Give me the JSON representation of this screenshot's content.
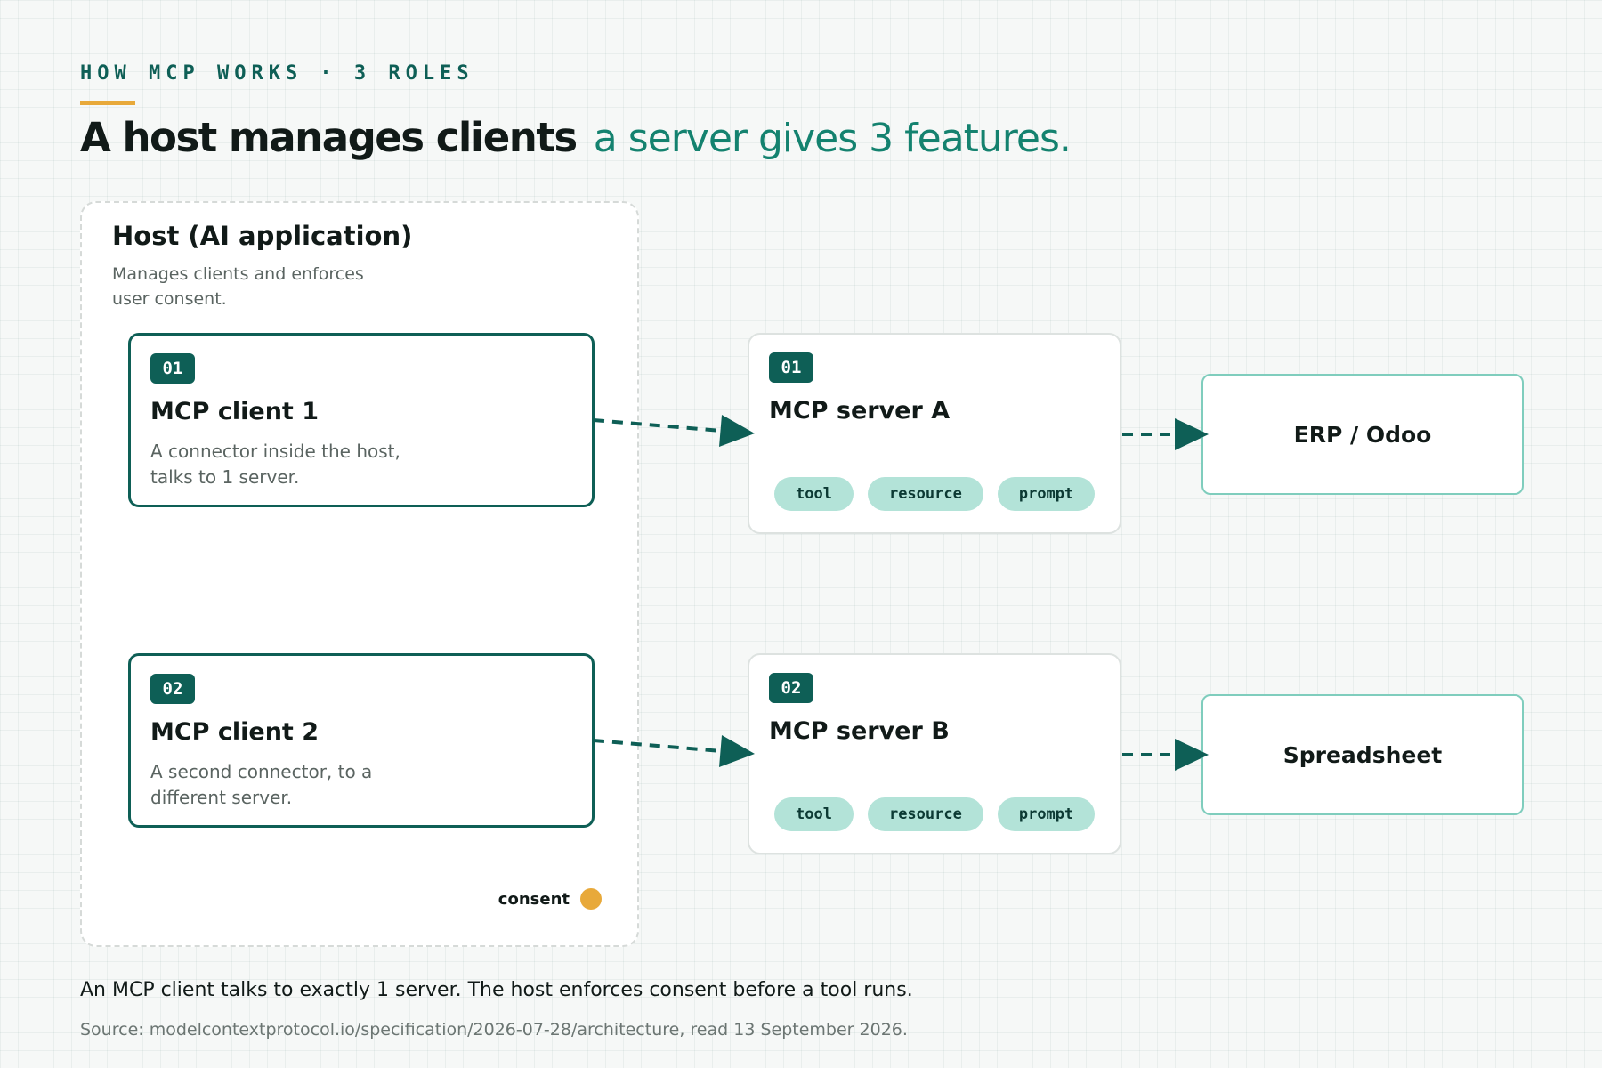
{
  "header": {
    "eyebrow": "HOW MCP WORKS · 3 ROLES",
    "title_strong": "A host manages clients",
    "title_light": "a server gives 3 features."
  },
  "host": {
    "title": "Host (AI application)",
    "description": "Manages clients and enforces user consent.",
    "consent_label": "consent",
    "clients": [
      {
        "badge": "01",
        "title": "MCP client 1",
        "description": "A connector inside the host, talks to 1 server."
      },
      {
        "badge": "02",
        "title": "MCP client 2",
        "description": "A second connector, to a different server."
      }
    ]
  },
  "servers": [
    {
      "badge": "01",
      "title": "MCP server A",
      "features": [
        "tool",
        "resource",
        "prompt"
      ],
      "target": "ERP / Odoo"
    },
    {
      "badge": "02",
      "title": "MCP server B",
      "features": [
        "tool",
        "resource",
        "prompt"
      ],
      "target": "Spreadsheet"
    }
  ],
  "footer": {
    "caption": "An MCP client talks to exactly 1 server. The host enforces consent before a tool runs.",
    "source": "Source: modelcontextprotocol.io/specification/2026-07-28/architecture, read 13 September 2026."
  },
  "colors": {
    "primary": "#0e5f56",
    "accent": "#e8a93a",
    "chip": "#b3e3d8",
    "highlight_text": "#14826f"
  }
}
